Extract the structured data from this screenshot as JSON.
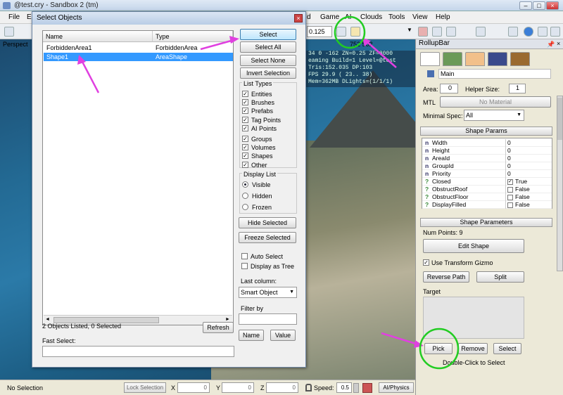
{
  "window": {
    "title": "@test.cry - Sandbox 2 (tm)"
  },
  "menu": {
    "file": "File",
    "edit_partial": "E",
    "d": "d",
    "game": "Game",
    "ai": "AI",
    "clouds": "Clouds",
    "tools": "Tools",
    "view": "View",
    "help": "Help"
  },
  "toolbar": {
    "snap_value": "0.125"
  },
  "viewport": {
    "label": "Perspect",
    "stats": [
      "34   0 -162 ZN=0.25 ZF=8000",
      "eaming Build=1 Level=@test",
      "Tris:152.035  DP:103",
      "FPS  29.9 ( 23.. 38)",
      "Mem=362MB DLights=(1/1/1)"
    ],
    "coords": "752   502"
  },
  "dialog": {
    "title": "Select Objects",
    "columns": {
      "name": "Name",
      "type": "Type"
    },
    "rows": [
      {
        "name": "ForbiddenArea1",
        "type": "ForbiddenArea",
        "selected": false
      },
      {
        "name": "Shape1",
        "type": "AreaShape",
        "selected": true
      }
    ],
    "buttons": {
      "select": "Select",
      "select_all": "Select All",
      "select_none": "Select None",
      "invert": "Invert Selection",
      "hide": "Hide Selected",
      "freeze": "Freeze Selected",
      "refresh": "Refresh",
      "name": "Name",
      "value": "Value"
    },
    "list_types_label": "List Types",
    "list_types": [
      {
        "label": "Entities",
        "checked": true
      },
      {
        "label": "Brushes",
        "checked": true
      },
      {
        "label": "Prefabs",
        "checked": true
      },
      {
        "label": "Tag Points",
        "checked": true
      },
      {
        "label": "AI Points",
        "checked": true
      },
      {
        "label": "Groups",
        "checked": true
      },
      {
        "label": "Volumes",
        "checked": true
      },
      {
        "label": "Shapes",
        "checked": true
      },
      {
        "label": "Other",
        "checked": true
      }
    ],
    "display_list_label": "Display List",
    "display_list": [
      {
        "label": "Visible",
        "on": true
      },
      {
        "label": "Hidden",
        "on": false
      },
      {
        "label": "Frozen",
        "on": false
      }
    ],
    "auto_select": "Auto Select",
    "display_tree": "Display as Tree",
    "last_column_label": "Last column:",
    "last_column_value": "Smart Object",
    "filter_label": "Filter by",
    "status": "2 Objects Listed,  0 Selected",
    "fast_select_label": "Fast Select:"
  },
  "rollup": {
    "title": "RollupBar",
    "main_label": "Main",
    "area_label": "Area:",
    "area_value": "0",
    "helper_label": "Helper Size:",
    "helper_value": "1",
    "mtl_label": "MTL",
    "mtl_value": "No Material",
    "minspec_label": "Minimal Spec:",
    "minspec_value": "All",
    "shape_params_header": "Shape Params",
    "properties": [
      {
        "icon": "n",
        "name": "Width",
        "value": "0"
      },
      {
        "icon": "n",
        "name": "Height",
        "value": "0"
      },
      {
        "icon": "n",
        "name": "AreaId",
        "value": "0"
      },
      {
        "icon": "n",
        "name": "GroupId",
        "value": "0"
      },
      {
        "icon": "n",
        "name": "Priority",
        "value": "0"
      },
      {
        "icon": "?",
        "name": "Closed",
        "value": "True"
      },
      {
        "icon": "?",
        "name": "ObstructRoof",
        "value": "False"
      },
      {
        "icon": "?",
        "name": "ObstructFloor",
        "value": "False"
      },
      {
        "icon": "?",
        "name": "DisplayFilled",
        "value": "False"
      }
    ],
    "shape_parameters_header": "Shape Parameters",
    "num_points": "Num Points: 9",
    "edit_shape": "Edit Shape",
    "use_gizmo": "Use Transform Gizmo",
    "reverse_path": "Reverse Path",
    "split": "Split",
    "target_label": "Target",
    "pick": "Pick",
    "remove": "Remove",
    "select": "Select",
    "hint": "Double-Click to Select"
  },
  "statusbar": {
    "text": "No Selection",
    "lock": "Lock Selection",
    "x_label": "X",
    "x": "0",
    "y_label": "Y",
    "y": "0",
    "z_label": "Z",
    "z": "0",
    "speed_label": "Speed:",
    "speed": "0.5",
    "ai_physics": "AI/Physics"
  },
  "colors": {
    "selection": "#3399ff",
    "annotation_arrow": "#e040e0",
    "annotation_circle": "#22cc22"
  }
}
